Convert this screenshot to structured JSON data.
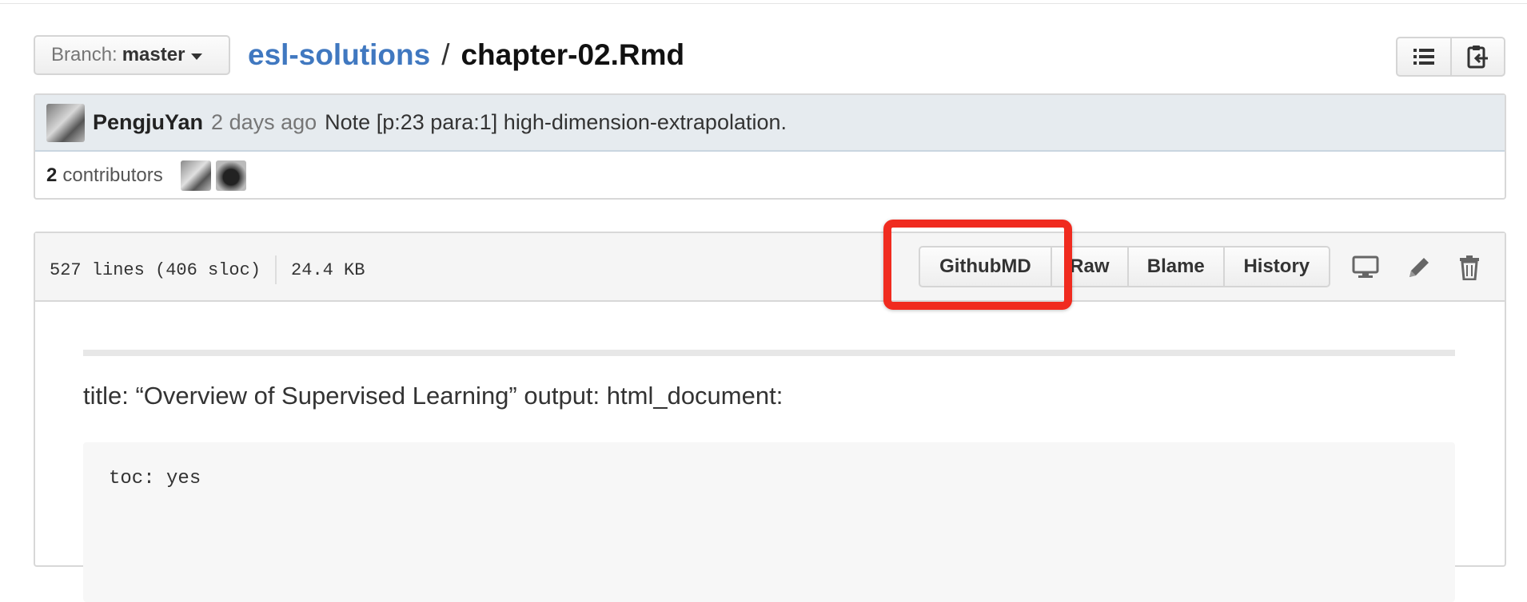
{
  "branch": {
    "label": "Branch:",
    "value": "master"
  },
  "breadcrumb": {
    "repo": "esl-solutions",
    "separator": "/",
    "file": "chapter-02.Rmd"
  },
  "commit": {
    "author": "PengjuYan",
    "time": "2 days ago",
    "message": "Note [p:23 para:1] high-dimension-extrapolation."
  },
  "contributors": {
    "count": "2",
    "label": "contributors"
  },
  "file_header": {
    "lines": "527 lines (406 sloc)",
    "size": "24.4 KB",
    "buttons": {
      "githubmd": "GithubMD",
      "raw": "Raw",
      "blame": "Blame",
      "history": "History"
    }
  },
  "content": {
    "paragraph": "title: “Overview of Supervised Learning” output: html_document:",
    "code": "toc: yes"
  },
  "colors": {
    "link": "#4078c0",
    "highlight": "#f02b1f",
    "commit_bg": "#e6ebef"
  },
  "icons": [
    "caret-down-icon",
    "list-icon",
    "clipboard-icon",
    "desktop-icon",
    "pencil-icon",
    "trash-icon"
  ]
}
